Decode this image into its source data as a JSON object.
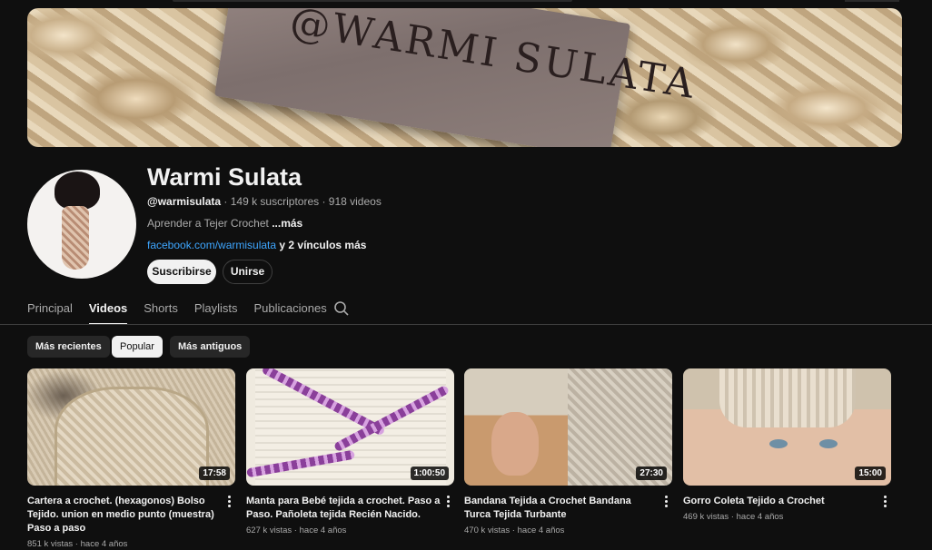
{
  "channel": {
    "name": "Warmi Sulata",
    "handle": "@warmisulata",
    "meta": " · 149 k suscriptores · 918 videos",
    "description": "Aprender a Tejer Crochet ",
    "description_more": "...más",
    "link": "facebook.com/warmisulata",
    "link_extra": " y 2 vínculos más",
    "banner_text": "@WARMI SULATA"
  },
  "actions": {
    "subscribe": "Suscribirse",
    "join": "Unirse"
  },
  "tabs": [
    {
      "label": "Principal",
      "active": false
    },
    {
      "label": "Videos",
      "active": true
    },
    {
      "label": "Shorts",
      "active": false
    },
    {
      "label": "Playlists",
      "active": false
    },
    {
      "label": "Publicaciones",
      "active": false
    }
  ],
  "tab_search_icon": "search-icon",
  "chips": [
    {
      "label": "Más recientes",
      "selected": false
    },
    {
      "label": "Popular",
      "selected": true
    },
    {
      "label": "Más antiguos",
      "selected": false
    }
  ],
  "videos": [
    {
      "title": "Cartera a crochet. (hexagonos) Bolso Tejido. union en medio punto (muestra) Paso a paso",
      "duration": "17:58",
      "views": "851 k vistas",
      "age": "hace 4 años"
    },
    {
      "title": "Manta para Bebé tejida a crochet. Paso a Paso. Pañoleta tejida Recién Nacido.",
      "duration": "1:00:50",
      "views": "627 k vistas",
      "age": "hace 4 años"
    },
    {
      "title": "Bandana Tejida a Crochet Bandana Turca Tejida Turbante",
      "duration": "27:30",
      "views": "470 k vistas",
      "age": "hace 4 años"
    },
    {
      "title": "Gorro Coleta Tejido a Crochet",
      "duration": "15:00",
      "views": "469 k vistas",
      "age": "hace 4 años"
    }
  ],
  "colors": {
    "background": "#0f0f0f",
    "text": "#f1f1f1",
    "muted": "#aaaaaa",
    "link": "#3ea6ff",
    "chip": "#272727"
  }
}
